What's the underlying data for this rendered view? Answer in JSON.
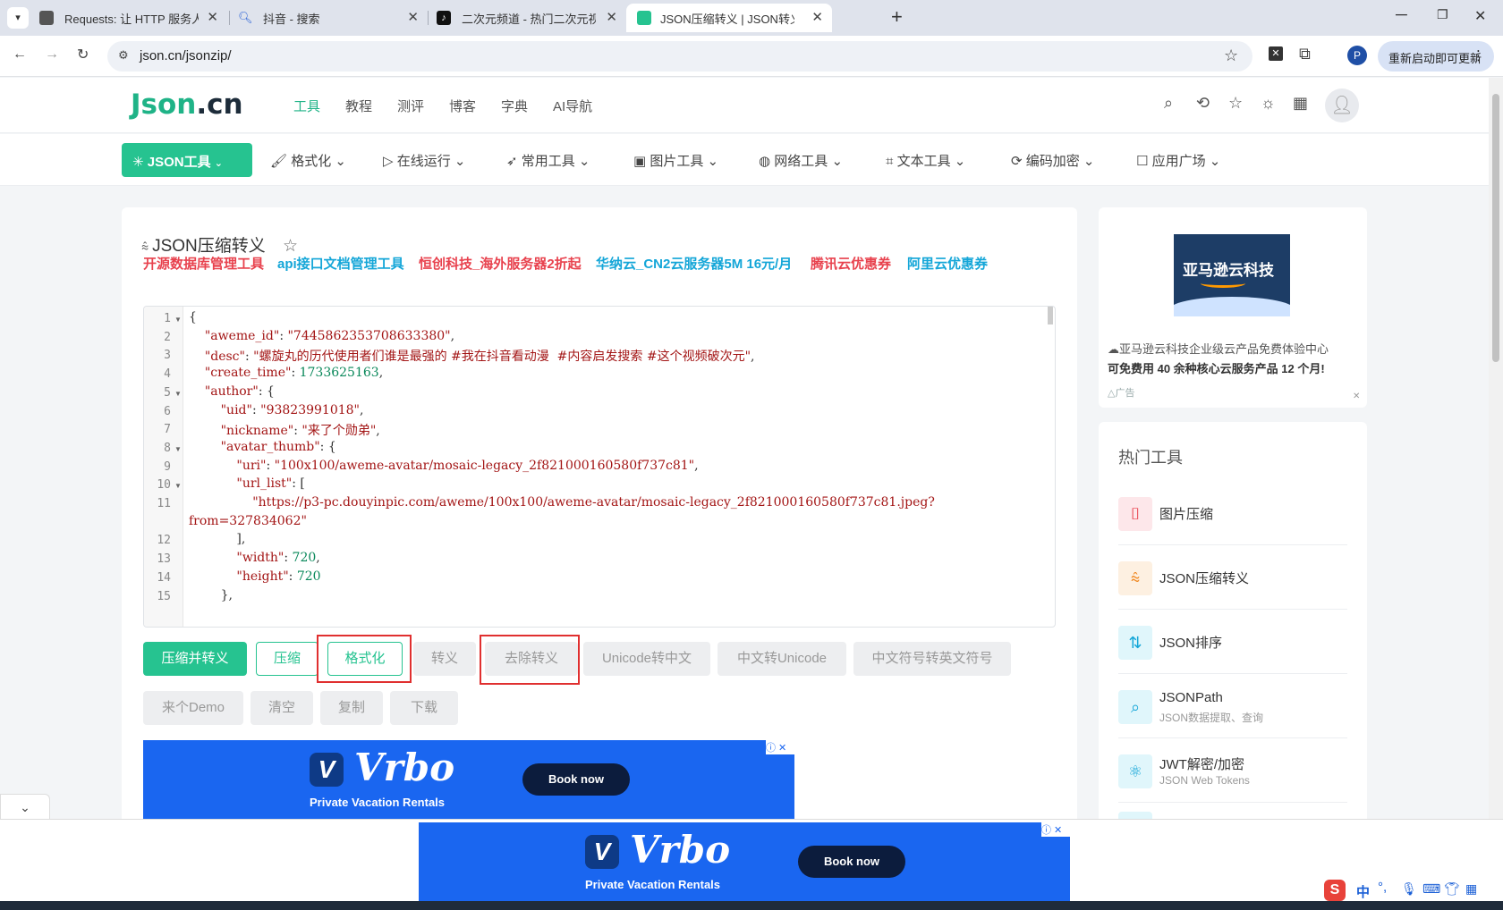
{
  "browser": {
    "tabs": [
      {
        "title": "Requests: 让 HTTP 服务人类 —",
        "active": false
      },
      {
        "title": "抖音 - 搜索",
        "active": false
      },
      {
        "title": "二次元频道 - 热门二次元视频大",
        "active": false
      },
      {
        "title": "JSON压缩转义 | JSON转义 | JS",
        "active": true
      }
    ],
    "new_tab": "+",
    "url": "json.cn/jsonzip/",
    "profile_initial": "P",
    "update_label": "重新启动即可更新"
  },
  "site": {
    "logo_main": "Json",
    "logo_tld": ".cn",
    "nav": [
      "工具",
      "教程",
      "测评",
      "博客",
      "字典",
      "AI导航"
    ],
    "categories": [
      "JSON工具",
      "格式化",
      "在线运行",
      "常用工具",
      "图片工具",
      "网络工具",
      "文本工具",
      "编码加密",
      "应用广场"
    ]
  },
  "tool": {
    "title": "JSON压缩转义",
    "promos": [
      {
        "text": "开源数据库管理工具",
        "color": "#e8424e"
      },
      {
        "text": "api接口文档管理工具",
        "color": "#14a6d8"
      },
      {
        "text": "恒创科技_海外服务器2折起",
        "color": "#e8424e"
      },
      {
        "text": "华纳云_CN2云服务器5M 16元/月",
        "color": "#14a6d8"
      },
      {
        "text": "腾讯云优惠券",
        "color": "#e8424e"
      },
      {
        "text": "阿里云优惠券",
        "color": "#14a6d8"
      }
    ],
    "code_lines": [
      "{",
      "    \"aweme_id\": \"7445862353708633380\",",
      "    \"desc\": \"螺旋丸的历代使用者们谁是最强的 #我在抖音看动漫  #内容启发搜索 #这个视频破次元\",",
      "    \"create_time\": 1733625163,",
      "    \"author\": {",
      "        \"uid\": \"93823991018\",",
      "        \"nickname\": \"来了个勋弟\",",
      "        \"avatar_thumb\": {",
      "            \"uri\": \"100x100/aweme-avatar/mosaic-legacy_2f821000160580f737c81\",",
      "            \"url_list\": [",
      "                \"https://p3-pc.douyinpic.com/aweme/100x100/aweme-avatar/mosaic-legacy_2f821000160580f737c81.jpeg?",
      "from=327834062\"",
      "            ],",
      "            \"width\": 720,",
      "            \"height\": 720",
      "        },"
    ],
    "line_numbers": [
      "1",
      "2",
      "3",
      "4",
      "5",
      "6",
      "7",
      "8",
      "9",
      "10",
      "11",
      "",
      "12",
      "13",
      "14",
      "15"
    ],
    "buttons_row1": [
      "压缩并转义",
      "压缩",
      "格式化",
      "转义",
      "去除转义",
      "Unicode转中文",
      "中文转Unicode",
      "中文符号转英文符号"
    ],
    "buttons_row2": [
      "来个Demo",
      "清空",
      "复制",
      "下载"
    ]
  },
  "ads": {
    "brand": "Vrbo",
    "tagline": "Private Vacation Rentals",
    "cta": "Book now"
  },
  "sidebar": {
    "amazon_title": "亚马逊云科技",
    "amazon_line1": "亚马逊云科技企业级云产品免费体验中心",
    "amazon_line2": "可免费用 40 余种核心云服务产品 12 个月!",
    "ad_label": "广告",
    "hot_title": "热门工具",
    "hot_items": [
      {
        "name": "图片压缩",
        "sub": ""
      },
      {
        "name": "JSON压缩转义",
        "sub": ""
      },
      {
        "name": "JSON排序",
        "sub": ""
      },
      {
        "name": "JSONPath",
        "sub": "JSON数据提取、查询"
      },
      {
        "name": "JWT解密/加密",
        "sub": "JSON Web Tokens"
      }
    ]
  },
  "ime": {
    "lang": "中"
  },
  "colors": {
    "accent": "#26c390",
    "highlight": "#e02f2f",
    "ad_blue": "#1a66f0"
  }
}
